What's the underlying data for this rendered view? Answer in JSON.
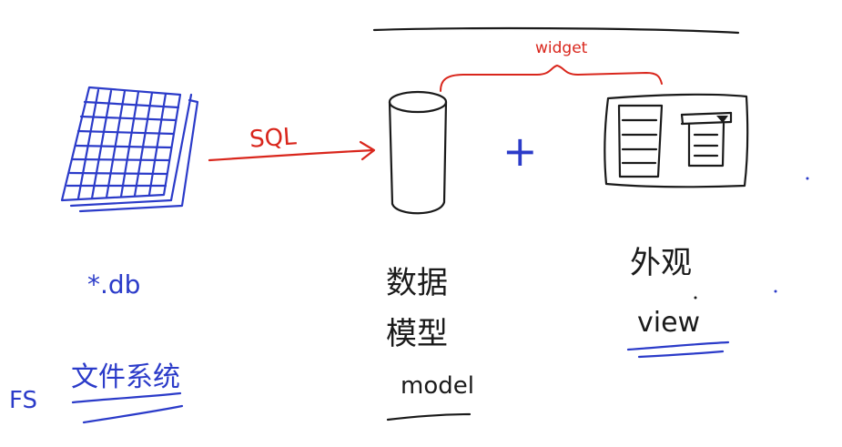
{
  "widget_label": "widget",
  "sql_label": "SQL",
  "plus_symbol": "+",
  "db_file_label": "*.db",
  "fs_abbrev": "FS",
  "fs_label_zh": "文件系统",
  "model_label_zh_line1": "数据",
  "model_label_zh_line2": "模型",
  "model_label_en": "model",
  "view_label_zh": "外观",
  "view_label_en": "view",
  "colors": {
    "red": "#d9261c",
    "blue": "#2b3bc9",
    "black": "#1a1a1a"
  }
}
